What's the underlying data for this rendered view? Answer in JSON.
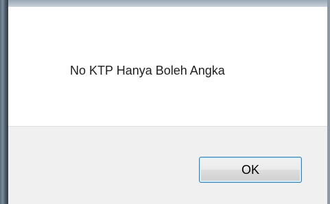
{
  "dialog": {
    "message": "No KTP Hanya Boleh Angka",
    "ok_label": "OK"
  },
  "colors": {
    "button_border": "#3c7fb1",
    "button_bar": "#f0f0f0",
    "message_background": "#ffffff"
  }
}
